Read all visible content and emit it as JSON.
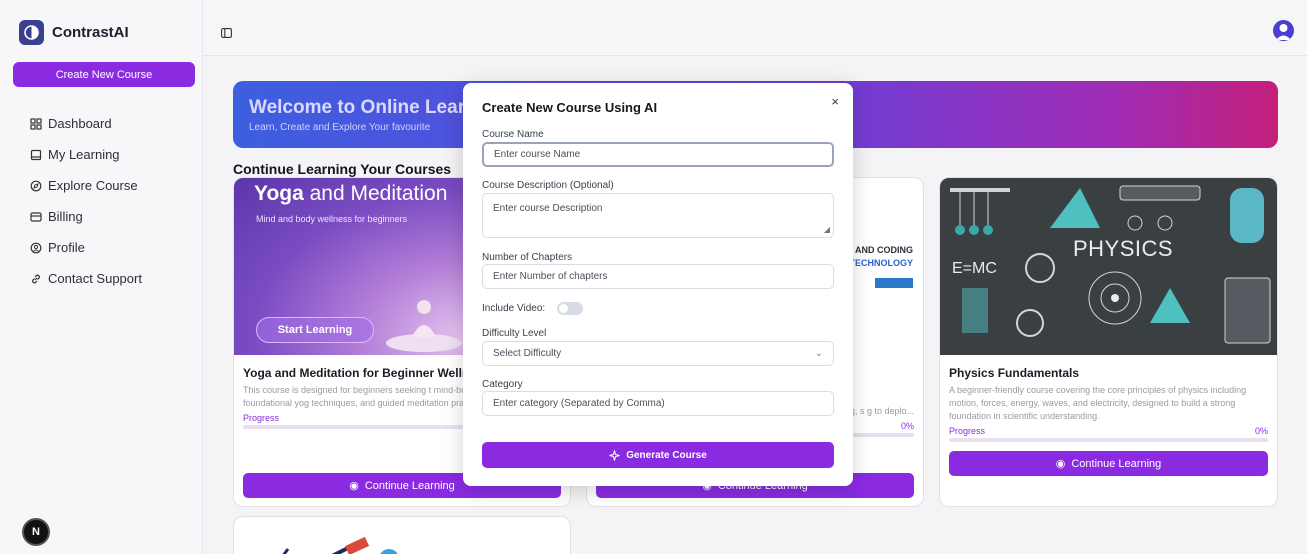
{
  "app": {
    "name": "ContrastAI"
  },
  "sidebar": {
    "create_label": "Create New Course",
    "items": [
      {
        "label": "Dashboard",
        "icon": "grid-icon"
      },
      {
        "label": "My Learning",
        "icon": "book-icon"
      },
      {
        "label": "Explore Course",
        "icon": "compass-icon"
      },
      {
        "label": "Billing",
        "icon": "wallet-icon"
      },
      {
        "label": "Profile",
        "icon": "user-circle-icon"
      },
      {
        "label": "Contact Support",
        "icon": "link-icon"
      }
    ],
    "bottom_avatar": "N"
  },
  "banner": {
    "title": "Welcome to Online Learn",
    "subtitle": "Learn, Create and Explore Your favourite"
  },
  "section_title": "Continue Learning Your Courses",
  "cards": [
    {
      "thumb_title_bold": "Yoga",
      "thumb_title_rest": " and Meditation",
      "thumb_sub": "Mind and body wellness for beginners",
      "thumb_button": "Start Learning",
      "title": "Yoga and Meditation for Beginner Wellness",
      "desc": "This course is designed for beginners seeking t mind-body wellness through foundational yog techniques, and guided meditation practices. L",
      "progress_label": "Progress",
      "progress_value": "",
      "button": "Continue Learning"
    },
    {
      "thumb_line1": "ING AND CODING",
      "thumb_line2": "TECHNOLOGY",
      "desc": "Learning, s g to deplo...",
      "progress_value": "0%",
      "button": "Continue Learning"
    },
    {
      "thumb_label": "PHYSICS",
      "title": "Physics Fundamentals",
      "desc": "A beginner-friendly course covering the core principles of physics including motion, forces, energy, waves, and electricity, designed to build a strong foundation in scientific understanding.",
      "progress_label": "Progress",
      "progress_value": "0%",
      "button": "Continue Learning"
    }
  ],
  "modal": {
    "title": "Create New Course Using AI",
    "close": "×",
    "name_label": "Course Name",
    "name_placeholder": "Enter course Name",
    "desc_label": "Course Description (Optional)",
    "desc_placeholder": "Enter course Description",
    "chapters_label": "Number of Chapters",
    "chapters_placeholder": "Enter Number of chapters",
    "video_label": "Include Video:",
    "video_enabled": false,
    "difficulty_label": "Difficulty Level",
    "difficulty_value": "Select Difficulty",
    "category_label": "Category",
    "category_placeholder": "Enter category (Separated by Comma)",
    "generate_label": "Generate Course"
  },
  "colors": {
    "accent": "#8a2be2",
    "brand": "#3b3f8f"
  }
}
